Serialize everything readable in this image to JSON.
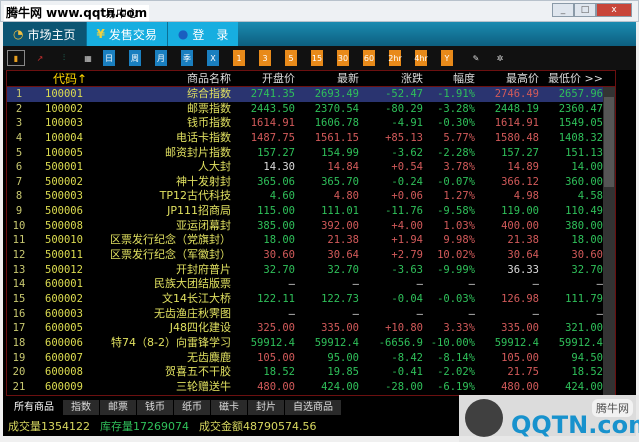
{
  "window": {
    "watermark": "腾牛网 www.qqtn.com",
    "title_suffix": "易中心",
    "minimize": "_",
    "maximize": "□",
    "close": "x"
  },
  "nav": [
    {
      "label": "市场主页"
    },
    {
      "label": "发售交易"
    },
    {
      "label": "登　录"
    }
  ],
  "toolbar": [
    "bar-chart",
    "line-chart",
    "candle-chart",
    "calendar",
    "日",
    "周",
    "月",
    "季",
    "X",
    "1",
    "3",
    "5",
    "15",
    "30",
    "60",
    "2hr",
    "4hr",
    "Y",
    "notes",
    "settings"
  ],
  "columns": [
    "代码↑",
    "商品名称",
    "开盘价",
    "最新",
    "涨跌",
    "幅度",
    "最高价",
    "最低价 >>"
  ],
  "rows": [
    [
      "1",
      "100001",
      "综合指数",
      "2741.35",
      "2693.49",
      "-52.47",
      "-1.91%",
      "2746.49",
      "2657.96",
      "gggg rg"
    ],
    [
      "2",
      "100002",
      "邮票指数",
      "2443.50",
      "2370.54",
      "-80.29",
      "-3.28%",
      "2448.19",
      "2360.47",
      "gggggg"
    ],
    [
      "3",
      "100003",
      "钱币指数",
      "1614.91",
      "1606.78",
      "-4.91",
      "-0.30%",
      "1614.91",
      "1549.05",
      "rgggrg"
    ],
    [
      "4",
      "100004",
      "电话卡指数",
      "1487.75",
      "1561.15",
      "+85.13",
      "5.77%",
      "1580.48",
      "1408.32",
      "rrrrrg"
    ],
    [
      "5",
      "100005",
      "邮资封片指数",
      "157.27",
      "154.99",
      "-3.62",
      "-2.28%",
      "157.27",
      "151.13",
      "gggggg"
    ],
    [
      "6",
      "500001",
      "人大封",
      "14.30",
      "14.84",
      "+0.54",
      "3.78%",
      "14.89",
      "14.00",
      "wrrrrg"
    ],
    [
      "7",
      "500002",
      "神十发射封",
      "365.06",
      "365.70",
      "-0.24",
      "-0.07%",
      "366.12",
      "360.00",
      "ggggrg"
    ],
    [
      "8",
      "500003",
      "TP12古代科技",
      "4.60",
      "4.80",
      "+0.06",
      "1.27%",
      "4.98",
      "4.58",
      "grrrrg"
    ],
    [
      "9",
      "500006",
      "JP111招商局",
      "115.00",
      "111.01",
      "-11.76",
      "-9.58%",
      "119.00",
      "110.49",
      "gggggg"
    ],
    [
      "10",
      "500008",
      "亚运闭幕封",
      "385.00",
      "392.00",
      "+4.00",
      "1.03%",
      "400.00",
      "380.00",
      "grrrrg"
    ],
    [
      "11",
      "500010",
      "区票发行纪念（党旗封）",
      "18.00",
      "21.38",
      "+1.94",
      "9.98%",
      "21.38",
      "18.00",
      "grrrrg"
    ],
    [
      "12",
      "500011",
      "区票发行纪念（军徽封）",
      "30.60",
      "30.64",
      "+2.79",
      "10.02%",
      "30.64",
      "30.60",
      "rrrrrr"
    ],
    [
      "13",
      "500012",
      "开封府普片",
      "32.70",
      "32.70",
      "-3.63",
      "-9.99%",
      "36.33",
      "32.70",
      "ggggwg"
    ],
    [
      "14",
      "600001",
      "民族大团结版票",
      "—",
      "—",
      "—",
      "—",
      "—",
      "—",
      "wwwwww"
    ],
    [
      "15",
      "600002",
      "文14长江大桥",
      "122.11",
      "122.73",
      "-0.04",
      "-0.03%",
      "126.98",
      "111.79",
      "ggggrg"
    ],
    [
      "16",
      "600003",
      "无齿渔庄秋霁图",
      "—",
      "—",
      "—",
      "—",
      "—",
      "—",
      "wwwwww"
    ],
    [
      "17",
      "600005",
      "J48四化建设",
      "325.00",
      "335.00",
      "+10.80",
      "3.33%",
      "335.00",
      "321.00",
      "rrrrrg"
    ],
    [
      "18",
      "600006",
      "特74（8-2）向雷锋学习",
      "59912.4",
      "59912.4",
      "-6656.9",
      "-10.00%",
      "59912.4",
      "59912.4",
      "gggggg"
    ],
    [
      "19",
      "600007",
      "无齿麋鹿",
      "105.00",
      "95.00",
      "-8.42",
      "-8.14%",
      "105.00",
      "94.50",
      "rgggrg"
    ],
    [
      "20",
      "600008",
      "贺喜五不干胶",
      "18.52",
      "19.85",
      "-0.41",
      "-2.02%",
      "21.75",
      "18.52",
      "ggggrg"
    ],
    [
      "21",
      "600009",
      "三轮赠送牛",
      "480.00",
      "424.00",
      "-28.00",
      "-6.19%",
      "480.00",
      "424.00",
      "rgggrg"
    ]
  ],
  "bottom_tabs": [
    "所有商品",
    "指数",
    "邮票",
    "钱币",
    "纸币",
    "磁卡",
    "封片",
    "自选商品"
  ],
  "status": {
    "volume_label": "成交量",
    "volume": "1354122",
    "stock_label": "库存量",
    "stock": "17269074",
    "amount_label": "成交金额",
    "amount": "48790574.56"
  },
  "logo": {
    "text": "QQTN.com",
    "badge": "腾牛网"
  }
}
